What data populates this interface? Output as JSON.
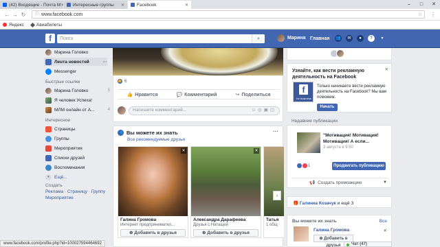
{
  "browser": {
    "tabs": [
      {
        "label": "(42) Входящие - Почта M",
        "color": "#005ff9",
        "active": false
      },
      {
        "label": "Интересные группы",
        "color": "#4267b2",
        "active": false
      },
      {
        "label": "Facebook",
        "color": "#4267b2",
        "active": true
      }
    ],
    "url": "www.facebook.com",
    "bookmarks": [
      {
        "label": "Яндекс",
        "color": "#f33"
      },
      {
        "label": "Авиабилеты",
        "color": "#333"
      }
    ]
  },
  "fb": {
    "logo": "f",
    "search_placeholder": "Поиск",
    "user_name": "Марина",
    "home_label": "Главная",
    "brand_color": "#4267b2"
  },
  "leftnav": {
    "profile": "Марина Головко",
    "feed": "Лента новостей",
    "messenger": "Messenger",
    "shortcuts_head": "Быстрые ссылки",
    "shortcuts": [
      {
        "label": "Марина Головко",
        "count": "5"
      },
      {
        "label": "Я человек Успеха!",
        "count": ""
      },
      {
        "label": "МЛМ онлайн от А...",
        "count": "4"
      }
    ],
    "interests_head": "Интересное",
    "interests": [
      {
        "label": "Страницы",
        "color": "#f0563b"
      },
      {
        "label": "Группы",
        "color": "#4a90e2"
      },
      {
        "label": "Мероприятия",
        "color": "#e04b3d"
      },
      {
        "label": "Списки друзей",
        "color": "#4267b2"
      },
      {
        "label": "Воспоминания",
        "color": "#3b87c9"
      }
    ],
    "more": "Ещё...",
    "create_head": "Создать",
    "create_links": "Реклама · Страницу · Группу",
    "create_links2": "Мероприятие"
  },
  "post": {
    "likes": "6",
    "like_label": "Нравится",
    "comment_label": "Комментарий",
    "share_label": "Поделиться",
    "comment_placeholder": "Напишите комментарий..."
  },
  "pymk": {
    "title": "Вы можете их знать",
    "see_all": "Все рекомендуемые друзья",
    "add_label": "Добавить в друзья",
    "people": [
      {
        "name": "Галина Громова",
        "sub": "Интернет предпринимател..."
      },
      {
        "name": "Александра Дарафеева",
        "sub": "Друзья с Натащей"
      },
      {
        "name": "Татья",
        "sub": "1 общ"
      }
    ]
  },
  "right": {
    "ad_title": "Узнайте, как вести рекламную деятельность на Facebook",
    "ad_logo_text": "for business",
    "ad_desc": "Только начинаете вести рекламную деятельность на Facebook? Мы вам поможем.",
    "ad_button": "Начать",
    "recent_head": "Недавние публикации",
    "pub_title": "\"Мотивация! Мотивация! Мотивация! А если...",
    "pub_date": "3 августа в 9:50",
    "pub_reacts": "1",
    "boost_label": "Продвигать публикацию",
    "promo_label": "Создать промоакцию",
    "birthday_name": "Галинка Козачук",
    "birthday_rest": " и ещё 3",
    "pymk_head": "Вы можете их знать",
    "pymk_all": "Все",
    "pymk_name": "Галина Громова",
    "pymk_add": "Добавить в друзья"
  },
  "status_url": "www.facebook.com/profile.php?id=100027594464692",
  "chat_label": "Чат (47)"
}
